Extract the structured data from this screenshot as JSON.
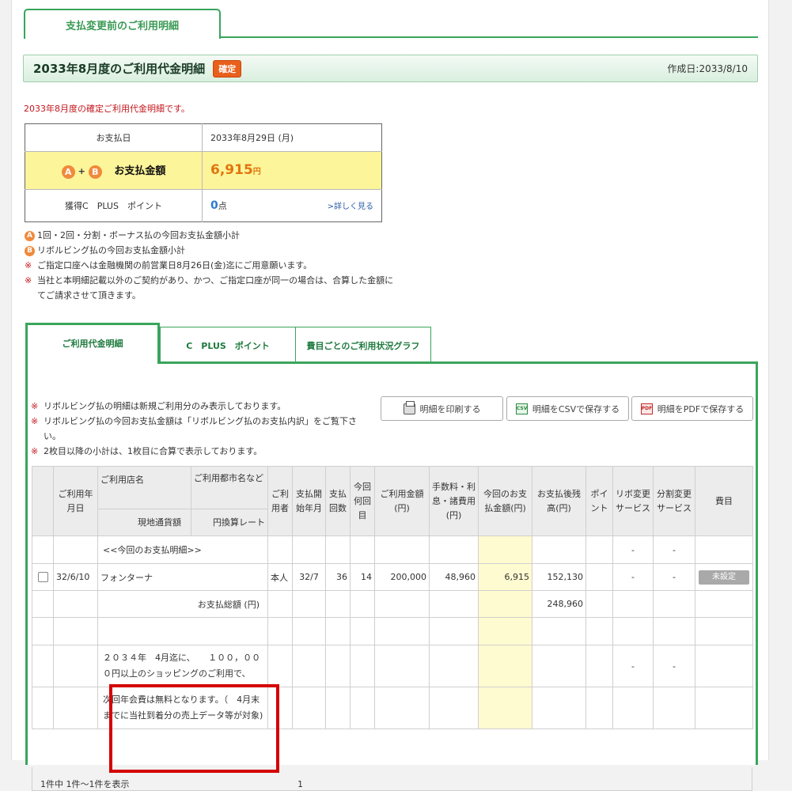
{
  "top_tab": "支払変更前のご利用明細",
  "header": {
    "title": "2033年8月度のご利用代金明細",
    "badge": "確定",
    "created": "作成日:2033/8/10"
  },
  "notice": "2033年8月度の確定ご利用代金明細です。",
  "summary": {
    "pay_date_label": "お支払日",
    "pay_date_value": "2033年8月29日 (月)",
    "circle_a": "A",
    "circle_b": "B",
    "plus": "+",
    "pay_amount_label": "お支払金額",
    "pay_amount_value": "6,915",
    "yen": "円",
    "points_label": "獲得C　PLUS　ポイント",
    "points_value": "0",
    "points_unit": "点",
    "detail_link": ">詳しく見る"
  },
  "notes": [
    {
      "mark": "A",
      "text": "1回・2回・分割・ボーナス払の今回お支払金額小計"
    },
    {
      "mark": "B",
      "text": "リボルビング払の今回お支払金額小計"
    },
    {
      "mark": "※",
      "text": "ご指定口座へは金融機関の前営業日8月26日(金)迄にご用意願います。"
    },
    {
      "mark": "※",
      "text": "当社と本明細記載以外のご契約があり、かつ、ご指定口座が同一の場合は、合算した金額にてご請求させて頂きます。"
    }
  ],
  "tabs": [
    "ご利用代金明細",
    "C　PLUS　ポイント",
    "費目ごとのご利用状況グラフ"
  ],
  "panel_notes": [
    "リボルビング払の明細は新規ご利用分のみ表示しております。",
    "リボルビング払の今回お支払金額は「リボルビング払のお支払内訳」をご覧下さい。",
    "2枚目以降の小計は、1枚目に合算で表示しております。"
  ],
  "panel_note_mark": "※",
  "buttons": {
    "print": "明細を印刷する",
    "csv": "明細をCSVで保存する",
    "pdf": "明細をPDFで保存する",
    "csv_icon": "CSV",
    "pdf_icon": "PDF"
  },
  "table": {
    "headers": {
      "date": "ご利用年月日",
      "shop": "ご利用店名",
      "city": "ご利用都市名など",
      "currency": "現地通貨額",
      "rate": "円換算レート",
      "user": "ご利用者",
      "start": "支払開始年月",
      "count": "支払回数",
      "nth": "今回何回目",
      "amount": "ご利用金額(円)",
      "fee": "手数料・利息・諸費用(円)",
      "this_pay": "今回のお支払金額(円)",
      "balance": "お支払後残高(円)",
      "point": "ポイント",
      "revo": "リボ変更サービス",
      "split": "分割変更サービス",
      "category": "費目"
    },
    "section_label": "<<今回のお支払明細>>",
    "dash": "-",
    "row": {
      "date": "32/6/10",
      "shop": "フォンターナ",
      "user": "本人",
      "start": "32/7",
      "count": "36",
      "nth": "14",
      "amount": "200,000",
      "fee": "48,960",
      "this_pay": "6,915",
      "balance": "152,130",
      "category_btn": "未設定"
    },
    "total_label": "お支払総額 (円)",
    "total_value": "248,960",
    "promo_1": "２０３４年　4月迄に、　　１００，０００円以上のショッピングのご利用で、",
    "promo_2": "次回年会費は無料となります。（　4月末までに当社到着分の売上データ等が対象)"
  },
  "footer": {
    "count": "1件中 1件〜1件を表示",
    "page": "1"
  }
}
